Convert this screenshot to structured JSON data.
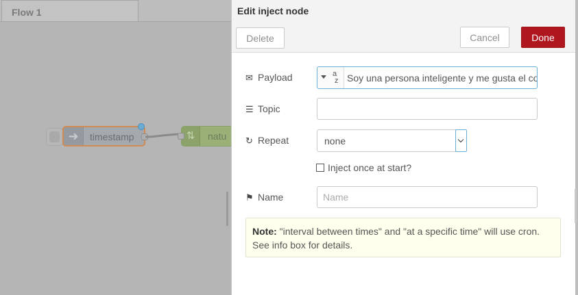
{
  "workspace": {
    "tab_label": "Flow 1",
    "nodes": [
      {
        "label": "timestamp",
        "icon": "arrow-right-icon",
        "color": "#a4a9ae",
        "selected_border": "#d08a52"
      },
      {
        "label": "natu",
        "icon": "shuffle-icon",
        "color": "#9ab077"
      }
    ]
  },
  "tray": {
    "title": "Edit inject node",
    "delete_label": "Delete",
    "cancel_label": "Cancel",
    "done_label": "Done",
    "done_color": "#b0161e",
    "fields": {
      "payload": {
        "label": "Payload",
        "icon": "envelope-icon",
        "type_icon": "a-z",
        "value": "Soy una persona inteligente y me gusta el co"
      },
      "topic": {
        "label": "Topic",
        "icon": "list-icon",
        "value": ""
      },
      "repeat": {
        "label": "Repeat",
        "icon": "repeat-icon",
        "value": "none"
      },
      "inject_once": {
        "label": "Inject once at start?",
        "checked": false
      },
      "name": {
        "label": "Name",
        "icon": "tag-icon",
        "placeholder": "Name",
        "value": ""
      }
    },
    "note": {
      "prefix": "Note:",
      "text": " \"interval between times\" and \"at a specific time\" will use cron. See info box for details."
    }
  }
}
